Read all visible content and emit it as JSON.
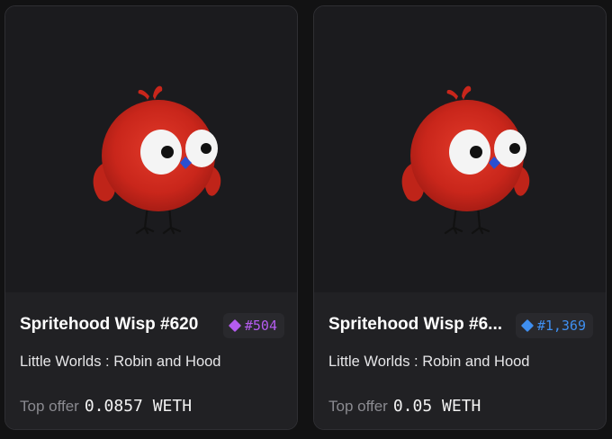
{
  "cards": [
    {
      "title": "Spritehood Wisp #620",
      "rank": "#504",
      "rank_color": "#b55cf0",
      "collection": "Little Worlds : Robin and Hood",
      "offer_label": "Top offer",
      "offer_value": "0.0857 WETH",
      "image_icon": "red-bird-icon"
    },
    {
      "title": "Spritehood Wisp #6...",
      "rank": "#1,369",
      "rank_color": "#3f8ff0",
      "collection": "Little Worlds : Robin and Hood",
      "offer_label": "Top offer",
      "offer_value": "0.05 WETH",
      "image_icon": "red-bird-icon"
    }
  ],
  "colors": {
    "background": "#121213",
    "card": "#212124",
    "bird_red": "#d12a1e"
  }
}
